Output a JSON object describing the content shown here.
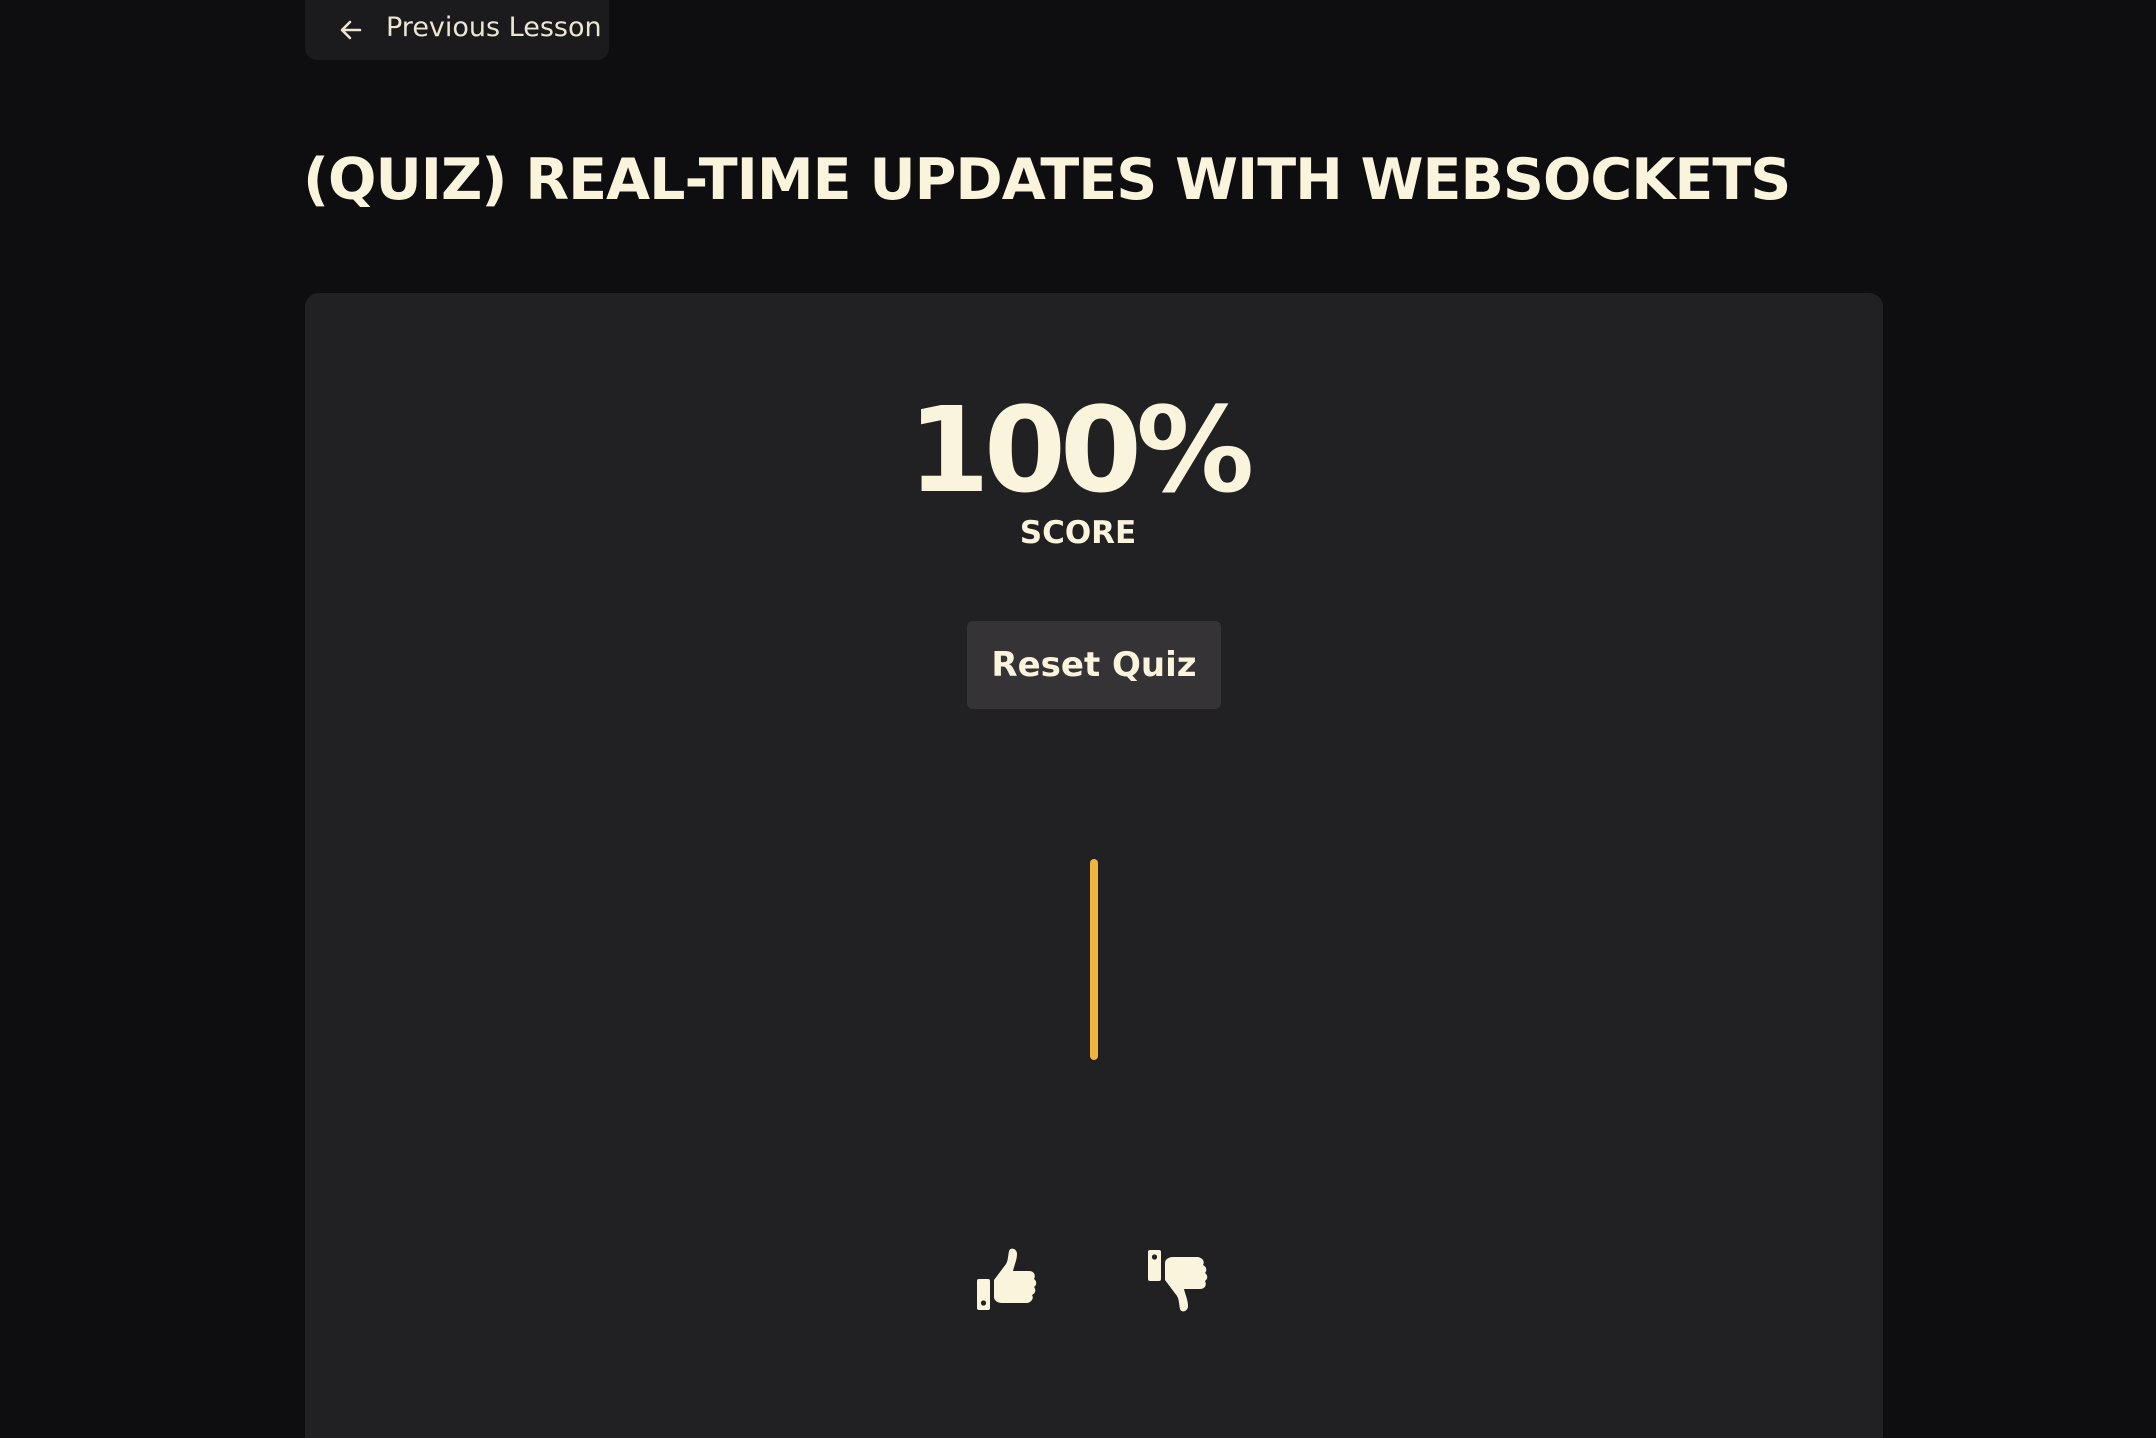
{
  "nav": {
    "previous_label": "Previous Lesson",
    "previous_icon": "arrow-left-icon"
  },
  "lesson": {
    "title": "(QUIZ) REAL-TIME UPDATES WITH WEBSOCKETS"
  },
  "quiz": {
    "score_value": "100%",
    "score_label": "SCORE",
    "reset_label": "Reset Quiz"
  },
  "feedback": {
    "up_icon": "thumbs-up-icon",
    "down_icon": "thumbs-down-icon"
  },
  "colors": {
    "background": "#0e0d0f",
    "card": "#212022",
    "button": "#353335",
    "text": "#faf4dc",
    "accent": "#f0b43c"
  }
}
